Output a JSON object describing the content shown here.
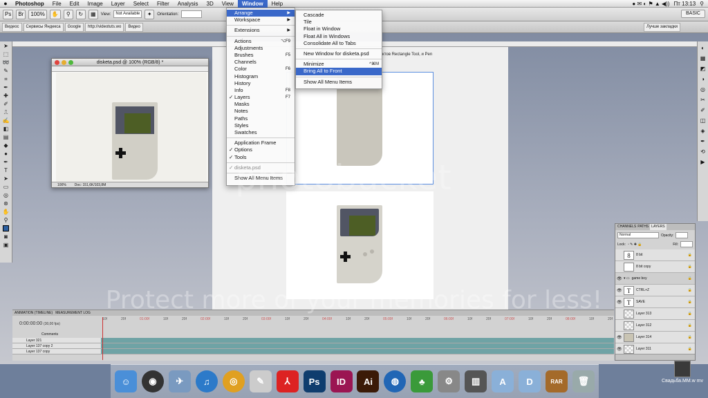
{
  "menubar": {
    "app": "Photoshop",
    "items": [
      "File",
      "Edit",
      "Image",
      "Layer",
      "Select",
      "Filter",
      "Analysis",
      "3D",
      "View",
      "Window",
      "Help"
    ],
    "clock": "Пт 13:13"
  },
  "options": {
    "zoom": "100%",
    "style_field": "Not Available",
    "orientation_label": "Orientation:",
    "view_label": "View:",
    "workspace": "BASIC"
  },
  "bookmarks": [
    "Видеос",
    "Сервисы Яндекса",
    "Google",
    "http://videotuts.wo",
    "Видео",
    "Лучше закладки"
  ],
  "window_menu": {
    "items": [
      {
        "label": "Arrange",
        "shortcut": "▶",
        "highlight": true
      },
      {
        "label": "Workspace",
        "shortcut": "▶"
      },
      {
        "sep": true
      },
      {
        "label": "Extensions",
        "shortcut": "▶"
      },
      {
        "sep": true
      },
      {
        "label": "Actions",
        "shortcut": "⌥F9"
      },
      {
        "label": "Adjustments",
        "shortcut": ""
      },
      {
        "label": "Brushes",
        "shortcut": "F5"
      },
      {
        "label": "Channels",
        "shortcut": ""
      },
      {
        "label": "Color",
        "shortcut": "F6"
      },
      {
        "label": "Histogram",
        "shortcut": ""
      },
      {
        "label": "History",
        "shortcut": ""
      },
      {
        "label": "Info",
        "shortcut": "F8"
      },
      {
        "label": "Layers",
        "shortcut": "F7",
        "checked": true
      },
      {
        "label": "Masks",
        "shortcut": ""
      },
      {
        "label": "Notes",
        "shortcut": ""
      },
      {
        "label": "Paths",
        "shortcut": ""
      },
      {
        "label": "Styles",
        "shortcut": ""
      },
      {
        "label": "Swatches",
        "shortcut": ""
      },
      {
        "sep": true
      },
      {
        "label": "Application Frame",
        "shortcut": ""
      },
      {
        "label": "Options",
        "shortcut": "",
        "checked": true
      },
      {
        "label": "Tools",
        "shortcut": "",
        "checked": true
      },
      {
        "sep": true
      },
      {
        "label": "disketa.psd",
        "shortcut": "",
        "checked": true,
        "dim": true
      },
      {
        "sep": true
      },
      {
        "label": "Show All Menu Items",
        "shortcut": ""
      }
    ]
  },
  "arrange_menu": {
    "items": [
      {
        "label": "Cascade",
        "shortcut": ""
      },
      {
        "label": "Tile",
        "shortcut": ""
      },
      {
        "label": "Float in Window",
        "shortcut": ""
      },
      {
        "label": "Float All in Windows",
        "shortcut": ""
      },
      {
        "label": "Consolidate All to Tabs",
        "shortcut": ""
      },
      {
        "sep": true
      },
      {
        "label": "New Window for disketa.psd",
        "shortcut": ""
      },
      {
        "sep": true
      },
      {
        "label": "Minimize",
        "shortcut": "^⌘M"
      },
      {
        "label": "Bring All to Front",
        "shortcut": "",
        "highlight": true
      },
      {
        "sep": true
      },
      {
        "label": "Show All Menu Items",
        "shortcut": ""
      }
    ]
  },
  "doc_window": {
    "title": "disketa.psd @ 100% (RGB/8) *",
    "zoom": "100%",
    "doc_info": "Doc: 151,6K/103,8M"
  },
  "canvas_stub": "ктов Rectangle Tool, и Pen",
  "timeline": {
    "tabs": [
      "ANIMATION (TIMELINE)",
      "MEASUREMENT LOG"
    ],
    "timecode": "0:00:00:00",
    "fps": "(30,00 fps)",
    "ticks": [
      "10f",
      "20f",
      "01:00f",
      "10f",
      "20f",
      "02:00f",
      "10f",
      "20f",
      "03:00f",
      "10f",
      "20f",
      "04:00f",
      "10f",
      "20f",
      "05:00f",
      "10f",
      "20f",
      "06:00f",
      "10f",
      "20f",
      "07:00f",
      "10f",
      "20f",
      "08:00f",
      "10f",
      "20f"
    ],
    "comments_label": "Comments",
    "rows": [
      "Layer 321",
      "Layer 137 copy 2",
      "Layer 137 copy"
    ]
  },
  "layers_panel": {
    "tabs": [
      "CHANNELS",
      "PATHS",
      "LAYERS"
    ],
    "blend_mode": "Normal",
    "opacity_label": "Opacity:",
    "lock_label": "Lock:",
    "fill_label": "Fill:",
    "layers": [
      {
        "name": "8 bit",
        "thumb": "8",
        "type": "img"
      },
      {
        "name": "8 bit copy",
        "thumb": "",
        "type": "img"
      },
      {
        "name": "game boy",
        "thumb": "",
        "type": "group"
      },
      {
        "name": "CTRL+Z",
        "thumb": "T",
        "type": "text"
      },
      {
        "name": "SAVE",
        "thumb": "T",
        "type": "text"
      },
      {
        "name": "Layer 313",
        "thumb": "",
        "type": "chk"
      },
      {
        "name": "Layer 312",
        "thumb": "",
        "type": "chk"
      },
      {
        "name": "Layer 314",
        "thumb": "",
        "type": "tan"
      },
      {
        "name": "Layer 311",
        "thumb": "",
        "type": "chk"
      }
    ]
  },
  "dock": {
    "items": [
      {
        "name": "finder",
        "label": "☺",
        "color": "#4a8fd8"
      },
      {
        "name": "dashboard",
        "label": "◉",
        "color": "#333"
      },
      {
        "name": "preview",
        "label": "✈",
        "color": "#7a9ac0"
      },
      {
        "name": "itunes",
        "label": "♫",
        "color": "#2c7ac9"
      },
      {
        "name": "chrome",
        "label": "◎",
        "color": "#e0a021"
      },
      {
        "name": "script-editor",
        "label": "✎",
        "color": "#ccc"
      },
      {
        "name": "acrobat",
        "label": "⅄",
        "color": "#d22"
      },
      {
        "name": "photoshop",
        "label": "Ps",
        "color": "#0f3d6e"
      },
      {
        "name": "indesign",
        "label": "ID",
        "color": "#9b1552"
      },
      {
        "name": "illustrator",
        "label": "Ai",
        "color": "#3b1a07"
      },
      {
        "name": "network",
        "label": "◍",
        "color": "#2166b5"
      },
      {
        "name": "adium",
        "label": "♣",
        "color": "#3a9a3a"
      },
      {
        "name": "system-preferences",
        "label": "⚙",
        "color": "#888"
      },
      {
        "name": "books",
        "label": "▥",
        "color": "#555"
      },
      {
        "name": "applications-folder",
        "label": "A",
        "color": "#8ab0d8"
      },
      {
        "name": "documents-folder",
        "label": "D",
        "color": "#8ab0d8"
      },
      {
        "name": "rar",
        "label": "RAR",
        "color": "#a46a2a"
      },
      {
        "name": "trash",
        "label": "🗑",
        "color": "#9aa"
      }
    ]
  },
  "desktop_file": "Свадьба.ММ.w mv",
  "watermark": {
    "logo": "photobucket",
    "text": "Protect more of your memories for less!"
  }
}
